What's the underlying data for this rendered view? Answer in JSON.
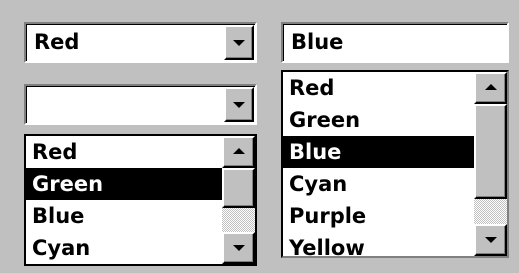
{
  "combo_top_left": {
    "value": "Red"
  },
  "combo_open_left": {
    "value": "",
    "items": [
      "Red",
      "Green",
      "Blue",
      "Cyan"
    ],
    "selected_index": 1
  },
  "combo_simple_right": {
    "value": "Blue",
    "items": [
      "Red",
      "Green",
      "Blue",
      "Cyan",
      "Purple",
      "Yellow"
    ],
    "selected_index": 2
  },
  "icons": {
    "dropdown": "chevron-down-icon",
    "scroll_up": "scroll-up-arrow-icon",
    "scroll_down": "scroll-down-arrow-icon"
  },
  "colors": {
    "face": "#c0c0c0",
    "selection_bg": "#000000",
    "selection_fg": "#ffffff"
  }
}
